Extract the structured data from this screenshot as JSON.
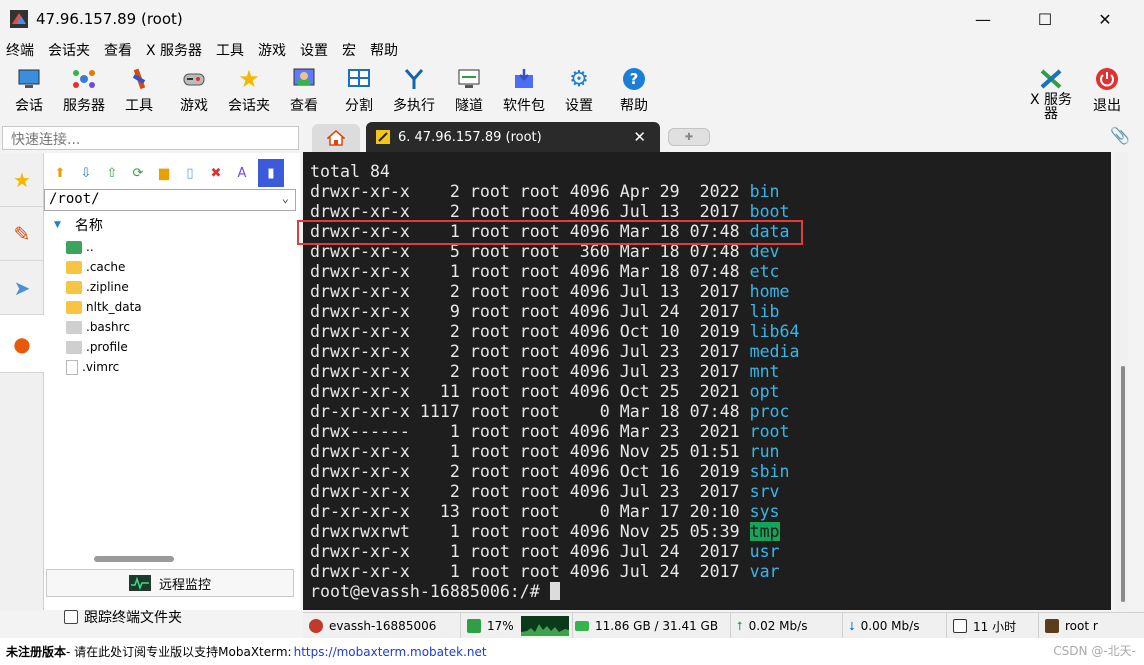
{
  "window": {
    "title": "47.96.157.89 (root)",
    "controls": [
      "—",
      "☐",
      "✕"
    ]
  },
  "menu": [
    "终端",
    "会话夹",
    "查看",
    "X 服务器",
    "工具",
    "游戏",
    "设置",
    "宏",
    "帮助"
  ],
  "toolbar": [
    {
      "label": "会话",
      "icon": "session-icon"
    },
    {
      "label": "服务器",
      "icon": "servers-icon"
    },
    {
      "label": "工具",
      "icon": "tools-icon"
    },
    {
      "label": "游戏",
      "icon": "games-icon"
    },
    {
      "label": "会话夹",
      "icon": "star-icon"
    },
    {
      "label": "查看",
      "icon": "view-icon"
    },
    {
      "label": "分割",
      "icon": "split-icon"
    },
    {
      "label": "多执行",
      "icon": "multiexec-icon"
    },
    {
      "label": "隧道",
      "icon": "tunnel-icon"
    },
    {
      "label": "软件包",
      "icon": "packages-icon"
    },
    {
      "label": "设置",
      "icon": "gear-icon"
    },
    {
      "label": "帮助",
      "icon": "help-icon"
    }
  ],
  "toolbar_right": {
    "xserver_label_1": "X 服务",
    "xserver_label_2": "器",
    "exit_label": "退出"
  },
  "quick_connect": {
    "placeholder": "快速连接..."
  },
  "tabs": {
    "active_title": "6. 47.96.157.89 (root)"
  },
  "sftp": {
    "path": "/root/",
    "column_name": "名称",
    "files": [
      {
        "name": "..",
        "type": "parent"
      },
      {
        "name": ".cache",
        "type": "folder"
      },
      {
        "name": ".zipline",
        "type": "folder"
      },
      {
        "name": "nltk_data",
        "type": "folder"
      },
      {
        "name": ".bashrc",
        "type": "file"
      },
      {
        "name": ".profile",
        "type": "file"
      },
      {
        "name": ".vimrc",
        "type": "textfile"
      }
    ],
    "monitor_label": "远程监控",
    "follow_label": "跟踪终端文件夹"
  },
  "terminal": {
    "header": "total 84",
    "rows": [
      {
        "meta": "drwxr-xr-x    2 root root 4096 Apr 29  2022 ",
        "name": "bin"
      },
      {
        "meta": "drwxr-xr-x    2 root root 4096 Jul 13  2017 ",
        "name": "boot"
      },
      {
        "meta": "drwxr-xr-x    1 root root 4096 Mar 18 07:48 ",
        "name": "data"
      },
      {
        "meta": "drwxr-xr-x    5 root root  360 Mar 18 07:48 ",
        "name": "dev"
      },
      {
        "meta": "drwxr-xr-x    1 root root 4096 Mar 18 07:48 ",
        "name": "etc"
      },
      {
        "meta": "drwxr-xr-x    2 root root 4096 Jul 13  2017 ",
        "name": "home"
      },
      {
        "meta": "drwxr-xr-x    9 root root 4096 Jul 24  2017 ",
        "name": "lib"
      },
      {
        "meta": "drwxr-xr-x    2 root root 4096 Oct 10  2019 ",
        "name": "lib64"
      },
      {
        "meta": "drwxr-xr-x    2 root root 4096 Jul 23  2017 ",
        "name": "media"
      },
      {
        "meta": "drwxr-xr-x    2 root root 4096 Jul 23  2017 ",
        "name": "mnt"
      },
      {
        "meta": "drwxr-xr-x   11 root root 4096 Oct 25  2021 ",
        "name": "opt"
      },
      {
        "meta": "dr-xr-xr-x 1117 root root    0 Mar 18 07:48 ",
        "name": "proc"
      },
      {
        "meta": "drwx------    1 root root 4096 Mar 23  2021 ",
        "name": "root"
      },
      {
        "meta": "drwxr-xr-x    1 root root 4096 Nov 25 01:51 ",
        "name": "run"
      },
      {
        "meta": "drwxr-xr-x    2 root root 4096 Oct 16  2019 ",
        "name": "sbin"
      },
      {
        "meta": "drwxr-xr-x    2 root root 4096 Jul 23  2017 ",
        "name": "srv"
      },
      {
        "meta": "dr-xr-xr-x   13 root root    0 Mar 17 20:10 ",
        "name": "sys"
      },
      {
        "meta": "drwxrwxrwt    1 root root 4096 Nov 25 05:39 ",
        "name": "tmp",
        "sticky": true
      },
      {
        "meta": "drwxr-xr-x    1 root root 4096 Jul 24  2017 ",
        "name": "usr"
      },
      {
        "meta": "drwxr-xr-x    1 root root 4096 Jul 24  2017 ",
        "name": "var"
      }
    ],
    "prompt": "root@evassh-16885006:/# "
  },
  "status": {
    "host": "evassh-16885006",
    "cpu": "17%",
    "memory": "11.86 GB / 31.41 GB",
    "upload": "0.02 Mb/s",
    "download": "0.00 Mb/s",
    "uptime": "11 小时",
    "user": "root r"
  },
  "bottom": {
    "unregistered": "未注册版本",
    "promo": " - 请在此处订阅专业版以支持MobaXterm: ",
    "link": "https://mobaxterm.mobatek.net",
    "watermark": "CSDN @-北天-"
  },
  "colors": {
    "terminal_bg": "#1e1e1e",
    "dir_color": "#35b7e9",
    "sticky_bg": "#17a35a",
    "highlight": "#e43a3a"
  }
}
